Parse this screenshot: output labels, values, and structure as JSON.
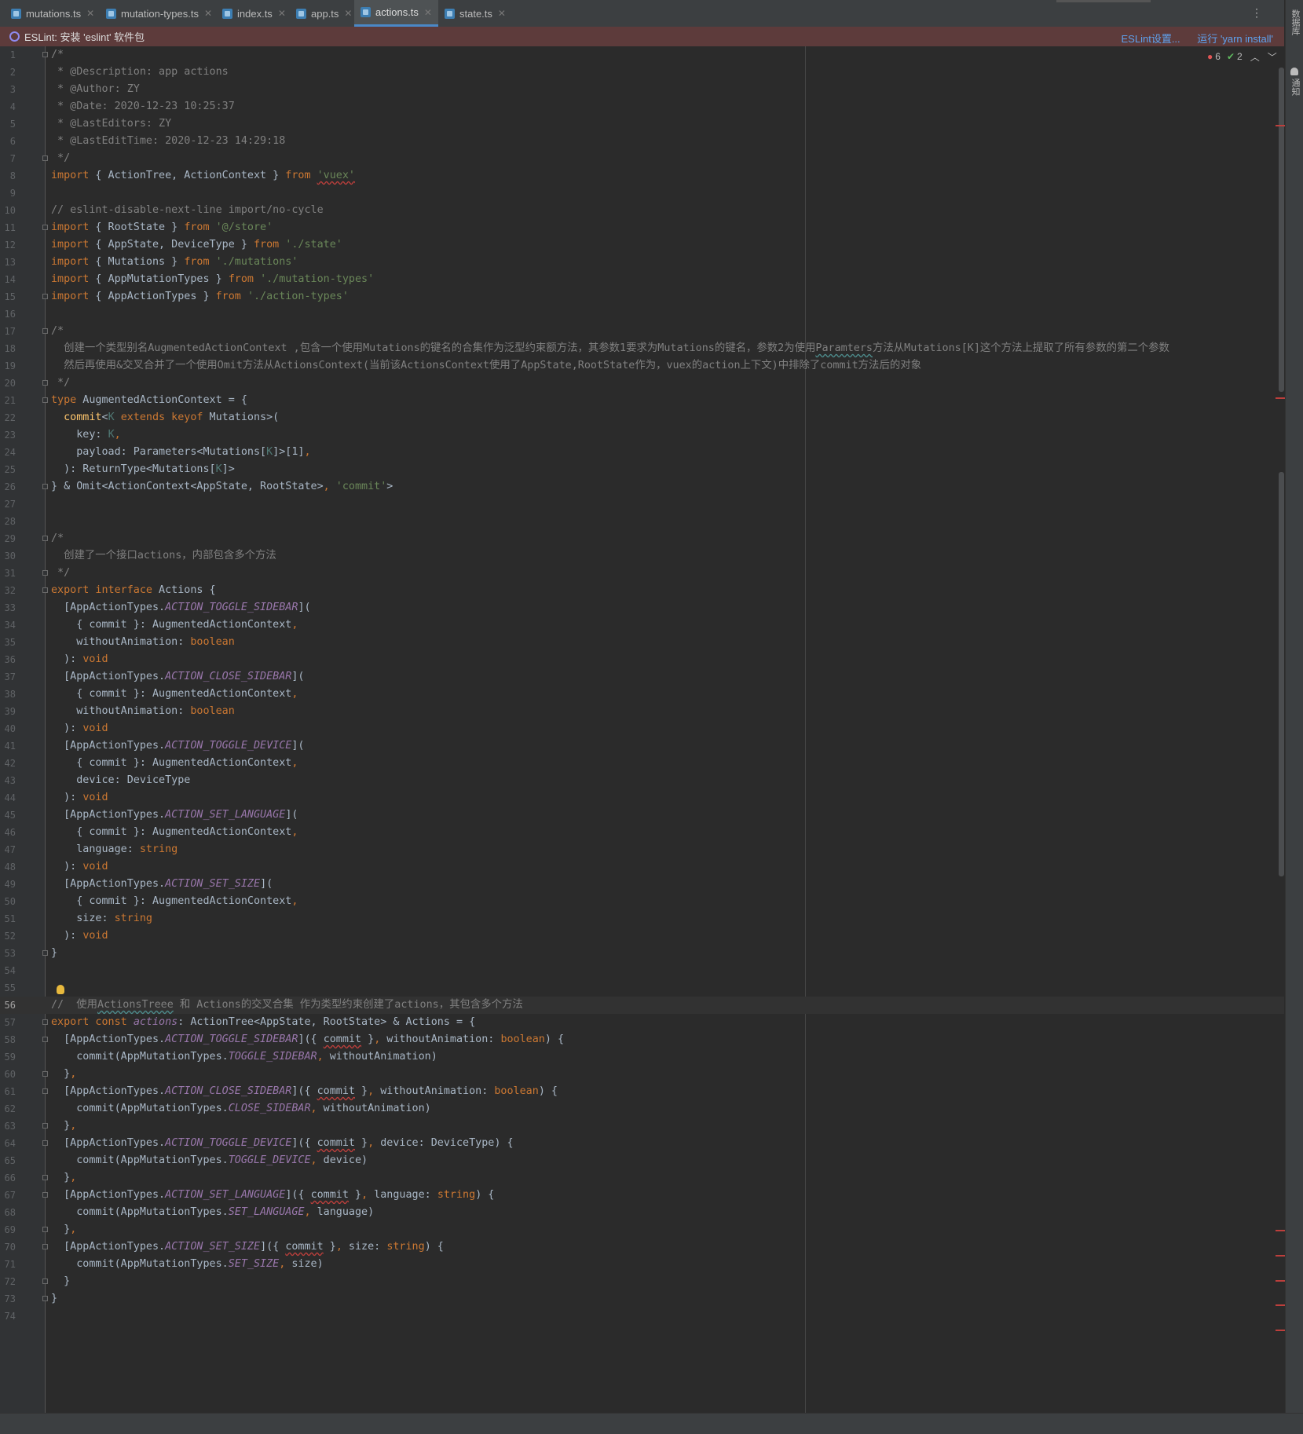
{
  "tabs": [
    {
      "label": "mutations.ts",
      "active": false
    },
    {
      "label": "mutation-types.ts",
      "active": false
    },
    {
      "label": "index.ts",
      "active": false
    },
    {
      "label": "app.ts",
      "active": false
    },
    {
      "label": "actions.ts",
      "active": true
    },
    {
      "label": "state.ts",
      "active": false
    }
  ],
  "banner": {
    "message": "ESLint: 安装 'eslint' 软件包",
    "settings_link": "ESLint设置...",
    "run_link": "运行 'yarn install'"
  },
  "inspection": {
    "errors": "6",
    "ok": "2"
  },
  "right_panel": {
    "database_label": "数据库",
    "notification_label": "通知"
  },
  "colors": {
    "keyword": "#cc7832",
    "string": "#6a8759",
    "comment": "#808080",
    "constant": "#9876aa",
    "background": "#2b2b2b"
  },
  "editor": {
    "current_line": 56,
    "lines": [
      [
        [
          "c",
          "/*"
        ]
      ],
      [
        [
          "c",
          " * @Description: app actions"
        ]
      ],
      [
        [
          "c",
          " * @Author: ZY"
        ]
      ],
      [
        [
          "c",
          " * @Date: 2020-12-23 10:25:37"
        ]
      ],
      [
        [
          "c",
          " * @LastEditors: ZY"
        ]
      ],
      [
        [
          "c",
          " * @LastEditTime: 2020-12-23 14:29:18"
        ]
      ],
      [
        [
          "c",
          " */"
        ]
      ],
      [
        [
          "k",
          "import"
        ],
        [
          "p",
          " { ActionTree, ActionContext } "
        ],
        [
          "k",
          "from"
        ],
        [
          "p",
          " "
        ],
        [
          "s err",
          "'vuex'"
        ]
      ],
      [],
      [
        [
          "c",
          "// eslint-disable-next-line import/no-cycle"
        ]
      ],
      [
        [
          "k",
          "import"
        ],
        [
          "p",
          " { RootState } "
        ],
        [
          "k",
          "from"
        ],
        [
          "p",
          " "
        ],
        [
          "s",
          "'@/store'"
        ]
      ],
      [
        [
          "k",
          "import"
        ],
        [
          "p",
          " { AppState, DeviceType } "
        ],
        [
          "k",
          "from"
        ],
        [
          "p",
          " "
        ],
        [
          "s",
          "'./state'"
        ]
      ],
      [
        [
          "k",
          "import"
        ],
        [
          "p",
          " { Mutations } "
        ],
        [
          "k",
          "from"
        ],
        [
          "p",
          " "
        ],
        [
          "s",
          "'./mutations'"
        ]
      ],
      [
        [
          "k",
          "import"
        ],
        [
          "p",
          " { AppMutationTypes } "
        ],
        [
          "k",
          "from"
        ],
        [
          "p",
          " "
        ],
        [
          "s",
          "'./mutation-types'"
        ]
      ],
      [
        [
          "k",
          "import"
        ],
        [
          "p",
          " { AppActionTypes } "
        ],
        [
          "k",
          "from"
        ],
        [
          "p",
          " "
        ],
        [
          "s",
          "'./action-types'"
        ]
      ],
      [],
      [
        [
          "c",
          "/*"
        ]
      ],
      [
        [
          "c",
          "  创建一个类型别名AugmentedActionContext ,包含一个使用Mutations的键名的合集作为泛型约束额方法，其参数1要求为Mutations的键名，参数2为使用"
        ],
        [
          "c warn",
          "Paramters"
        ],
        [
          "c",
          "方法从Mutations[K]这个方法上提取了所有参数的第二个参数"
        ]
      ],
      [
        [
          "c",
          "  然后再使用&交叉合并了一个使用Omit方法从ActionsContext(当前该ActionsContext使用了AppState,RootState作为，vuex的action上下文)中排除了commit方法后的对象"
        ]
      ],
      [
        [
          "c",
          " */"
        ]
      ],
      [
        [
          "k",
          "type"
        ],
        [
          "p",
          " AugmentedActionContext = {"
        ]
      ],
      [
        [
          "p",
          "  "
        ],
        [
          "fn",
          "commit"
        ],
        [
          "p",
          "<"
        ],
        [
          "tp",
          "K"
        ],
        [
          "p",
          " "
        ],
        [
          "k",
          "extends keyof"
        ],
        [
          "p",
          " Mutations>("
        ]
      ],
      [
        [
          "p",
          "    key: "
        ],
        [
          "tp",
          "K"
        ],
        [
          "k",
          ","
        ]
      ],
      [
        [
          "p",
          "    payload: Parameters<Mutations["
        ],
        [
          "tp",
          "K"
        ],
        [
          "p",
          "]>[1]"
        ],
        [
          "k",
          ","
        ]
      ],
      [
        [
          "p",
          "  ): ReturnType<Mutations["
        ],
        [
          "tp",
          "K"
        ],
        [
          "p",
          "]>"
        ]
      ],
      [
        [
          "p",
          "} & Omit<ActionContext<AppState, RootState>"
        ],
        [
          "k",
          ","
        ],
        [
          "p",
          " "
        ],
        [
          "s",
          "'commit'"
        ],
        [
          "p",
          ">"
        ]
      ],
      [],
      [],
      [
        [
          "c",
          "/*"
        ]
      ],
      [
        [
          "c",
          "  创建了一个接口actions，内部包含多个方法"
        ]
      ],
      [
        [
          "c",
          " */"
        ]
      ],
      [
        [
          "k",
          "export interface"
        ],
        [
          "p",
          " Actions {"
        ]
      ],
      [
        [
          "p",
          "  [AppActionTypes."
        ],
        [
          "cn",
          "ACTION_TOGGLE_SIDEBAR"
        ],
        [
          "p",
          "]("
        ]
      ],
      [
        [
          "p",
          "    { commit }: AugmentedActionContext"
        ],
        [
          "k",
          ","
        ]
      ],
      [
        [
          "p",
          "    withoutAnimation: "
        ],
        [
          "k",
          "boolean"
        ]
      ],
      [
        [
          "p",
          "  ): "
        ],
        [
          "k",
          "void"
        ]
      ],
      [
        [
          "p",
          "  [AppActionTypes."
        ],
        [
          "cn",
          "ACTION_CLOSE_SIDEBAR"
        ],
        [
          "p",
          "]("
        ]
      ],
      [
        [
          "p",
          "    { commit }: AugmentedActionContext"
        ],
        [
          "k",
          ","
        ]
      ],
      [
        [
          "p",
          "    withoutAnimation: "
        ],
        [
          "k",
          "boolean"
        ]
      ],
      [
        [
          "p",
          "  ): "
        ],
        [
          "k",
          "void"
        ]
      ],
      [
        [
          "p",
          "  [AppActionTypes."
        ],
        [
          "cn",
          "ACTION_TOGGLE_DEVICE"
        ],
        [
          "p",
          "]("
        ]
      ],
      [
        [
          "p",
          "    { commit }: AugmentedActionContext"
        ],
        [
          "k",
          ","
        ]
      ],
      [
        [
          "p",
          "    device: DeviceType"
        ]
      ],
      [
        [
          "p",
          "  ): "
        ],
        [
          "k",
          "void"
        ]
      ],
      [
        [
          "p",
          "  [AppActionTypes."
        ],
        [
          "cn",
          "ACTION_SET_LANGUAGE"
        ],
        [
          "p",
          "]("
        ]
      ],
      [
        [
          "p",
          "    { commit }: AugmentedActionContext"
        ],
        [
          "k",
          ","
        ]
      ],
      [
        [
          "p",
          "    language: "
        ],
        [
          "k",
          "string"
        ]
      ],
      [
        [
          "p",
          "  ): "
        ],
        [
          "k",
          "void"
        ]
      ],
      [
        [
          "p",
          "  [AppActionTypes."
        ],
        [
          "cn",
          "ACTION_SET_SIZE"
        ],
        [
          "p",
          "]("
        ]
      ],
      [
        [
          "p",
          "    { commit }: AugmentedActionContext"
        ],
        [
          "k",
          ","
        ]
      ],
      [
        [
          "p",
          "    size: "
        ],
        [
          "k",
          "string"
        ]
      ],
      [
        [
          "p",
          "  ): "
        ],
        [
          "k",
          "void"
        ]
      ],
      [
        [
          "p",
          "}"
        ]
      ],
      [],
      [],
      [
        [
          "c",
          "//  使用"
        ],
        [
          "c warn",
          "ActionsTreee"
        ],
        [
          "c",
          " 和 Actions的交叉合集 作为类型约束创建了actions，其包含多个方法"
        ]
      ],
      [
        [
          "k",
          "export const"
        ],
        [
          "p",
          " "
        ],
        [
          "cn",
          "actions"
        ],
        [
          "p",
          ": ActionTree<AppState, RootState> & Actions = {"
        ]
      ],
      [
        [
          "p",
          "  [AppActionTypes."
        ],
        [
          "cn",
          "ACTION_TOGGLE_SIDEBAR"
        ],
        [
          "p",
          "]({ "
        ],
        [
          "p err",
          "commit"
        ],
        [
          "p",
          " }"
        ],
        [
          "k",
          ","
        ],
        [
          "p",
          " withoutAnimation: "
        ],
        [
          "k",
          "boolean"
        ],
        [
          "p",
          ") {"
        ]
      ],
      [
        [
          "p",
          "    commit(AppMutationTypes."
        ],
        [
          "cn",
          "TOGGLE_SIDEBAR"
        ],
        [
          "k",
          ","
        ],
        [
          "p",
          " withoutAnimation)"
        ]
      ],
      [
        [
          "p",
          "  }"
        ],
        [
          "k",
          ","
        ]
      ],
      [
        [
          "p",
          "  [AppActionTypes."
        ],
        [
          "cn",
          "ACTION_CLOSE_SIDEBAR"
        ],
        [
          "p",
          "]({ "
        ],
        [
          "p err",
          "commit"
        ],
        [
          "p",
          " }"
        ],
        [
          "k",
          ","
        ],
        [
          "p",
          " withoutAnimation: "
        ],
        [
          "k",
          "boolean"
        ],
        [
          "p",
          ") {"
        ]
      ],
      [
        [
          "p",
          "    commit(AppMutationTypes."
        ],
        [
          "cn",
          "CLOSE_SIDEBAR"
        ],
        [
          "k",
          ","
        ],
        [
          "p",
          " withoutAnimation)"
        ]
      ],
      [
        [
          "p",
          "  }"
        ],
        [
          "k",
          ","
        ]
      ],
      [
        [
          "p",
          "  [AppActionTypes."
        ],
        [
          "cn",
          "ACTION_TOGGLE_DEVICE"
        ],
        [
          "p",
          "]({ "
        ],
        [
          "p err",
          "commit"
        ],
        [
          "p",
          " }"
        ],
        [
          "k",
          ","
        ],
        [
          "p",
          " device: DeviceType) {"
        ]
      ],
      [
        [
          "p",
          "    commit(AppMutationTypes."
        ],
        [
          "cn",
          "TOGGLE_DEVICE"
        ],
        [
          "k",
          ","
        ],
        [
          "p",
          " device)"
        ]
      ],
      [
        [
          "p",
          "  }"
        ],
        [
          "k",
          ","
        ]
      ],
      [
        [
          "p",
          "  [AppActionTypes."
        ],
        [
          "cn",
          "ACTION_SET_LANGUAGE"
        ],
        [
          "p",
          "]({ "
        ],
        [
          "p err",
          "commit"
        ],
        [
          "p",
          " }"
        ],
        [
          "k",
          ","
        ],
        [
          "p",
          " language: "
        ],
        [
          "k",
          "string"
        ],
        [
          "p",
          ") {"
        ]
      ],
      [
        [
          "p",
          "    commit(AppMutationTypes."
        ],
        [
          "cn",
          "SET_LANGUAGE"
        ],
        [
          "k",
          ","
        ],
        [
          "p",
          " language)"
        ]
      ],
      [
        [
          "p",
          "  }"
        ],
        [
          "k",
          ","
        ]
      ],
      [
        [
          "p",
          "  [AppActionTypes."
        ],
        [
          "cn",
          "ACTION_SET_SIZE"
        ],
        [
          "p",
          "]({ "
        ],
        [
          "p err",
          "commit"
        ],
        [
          "p",
          " }"
        ],
        [
          "k",
          ","
        ],
        [
          "p",
          " size: "
        ],
        [
          "k",
          "string"
        ],
        [
          "p",
          ") {"
        ]
      ],
      [
        [
          "p",
          "    commit(AppMutationTypes."
        ],
        [
          "cn",
          "SET_SIZE"
        ],
        [
          "k",
          ","
        ],
        [
          "p",
          " size)"
        ]
      ],
      [
        [
          "p",
          "  }"
        ]
      ],
      [
        [
          "p",
          "}"
        ]
      ],
      []
    ],
    "fold_lines": [
      1,
      7,
      11,
      15,
      17,
      20,
      21,
      26,
      29,
      31,
      32,
      53,
      57,
      58,
      60,
      61,
      63,
      64,
      66,
      67,
      69,
      70,
      72,
      73
    ]
  }
}
